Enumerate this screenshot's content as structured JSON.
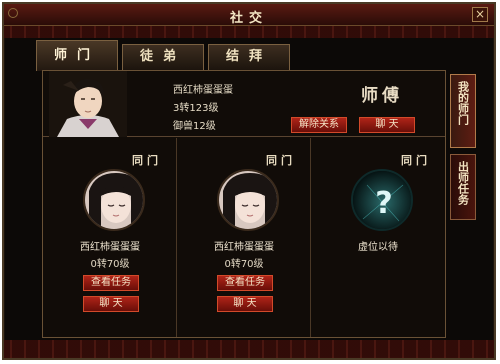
{
  "window": {
    "title": "社交",
    "close_label": "×"
  },
  "tabs": [
    {
      "label": "师门",
      "active": true
    },
    {
      "label": "徒弟",
      "active": false
    },
    {
      "label": "结拜",
      "active": false
    }
  ],
  "side_tabs": [
    {
      "label": "我的师门",
      "active": true
    },
    {
      "label": "出师任务",
      "active": false
    }
  ],
  "master": {
    "name": "西红柿蛋蛋蛋",
    "rebirth_level": "3转123级",
    "pet_level": "御兽12级",
    "role_label": "师傅",
    "dissolve_label": "解除关系",
    "chat_label": "聊 天"
  },
  "members": [
    {
      "title": "同门",
      "name": "西红柿蛋蛋蛋",
      "level": "0转70级",
      "task_label": "查看任务",
      "chat_label": "聊 天",
      "empty": false
    },
    {
      "title": "同门",
      "name": "西红柿蛋蛋蛋",
      "level": "0转70级",
      "task_label": "查看任务",
      "chat_label": "聊 天",
      "empty": false
    },
    {
      "title": "同门",
      "name": "虚位以待",
      "empty": true
    }
  ],
  "colors": {
    "accent_red": "#b02418",
    "frame_gold": "#7a6040",
    "background": "#0c0907"
  }
}
